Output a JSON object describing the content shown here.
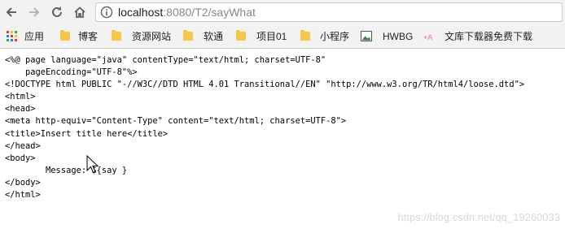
{
  "browser": {
    "url_host": "localhost",
    "url_rest": ":8080/T2/sayWhat"
  },
  "bookmarks": [
    {
      "label": "应用",
      "icon": "apps-grid-icon"
    },
    {
      "label": "博客",
      "icon": "folder-icon"
    },
    {
      "label": "资源网站",
      "icon": "folder-icon"
    },
    {
      "label": "软通",
      "icon": "folder-icon"
    },
    {
      "label": "项目01",
      "icon": "folder-icon"
    },
    {
      "label": "小程序",
      "icon": "folder-icon"
    },
    {
      "label": "HWBG",
      "icon": "image-icon"
    },
    {
      "label": "文库下载器免费下载",
      "icon": "site-favicon"
    }
  ],
  "page": {
    "lines": [
      "<%@ page language=\"java\" contentType=\"text/html; charset=UTF-8\"",
      "    pageEncoding=\"UTF-8\"%>",
      "<!DOCTYPE html PUBLIC \"-//W3C//DTD HTML 4.01 Transitional//EN\" \"http://www.w3.org/TR/html4/loose.dtd\">",
      "<html>",
      "<head>",
      "<meta http-equiv=\"Content-Type\" content=\"text/html; charset=UTF-8\">",
      "<title>Insert title here</title>",
      "</head>",
      "<body>",
      "        Message: ${say }",
      "</body>",
      "</html>"
    ]
  },
  "watermark": "https://blog.csdn.net/qq_19260033",
  "colors": {
    "toolbar_bg": "#f2f2f2",
    "folder": "#f4c84a",
    "url_host": "#222222",
    "url_rest": "#888888"
  }
}
